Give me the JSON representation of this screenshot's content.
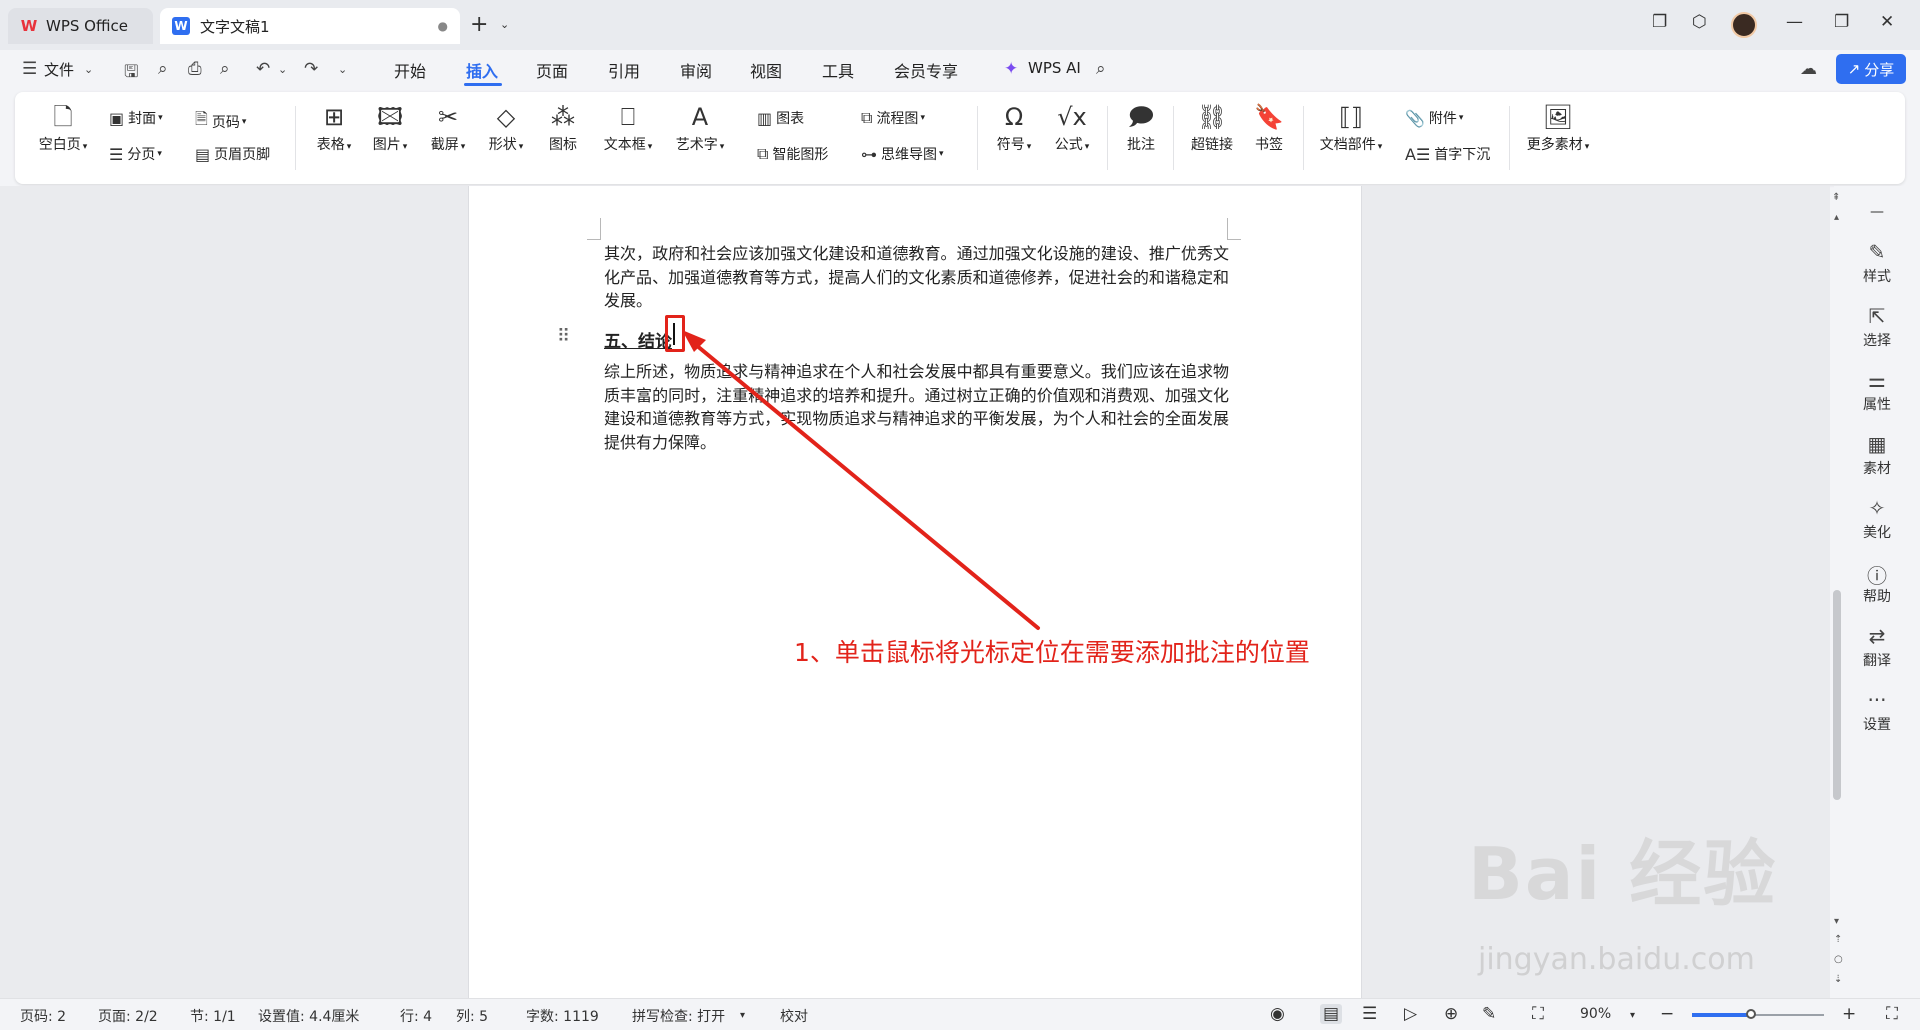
{
  "tabs": {
    "app_tab": "WPS Office",
    "doc_tab": "文字文稿1",
    "doc_tab_modified_dot": "●",
    "new_tab": "+"
  },
  "menu": {
    "file": "文件",
    "items": [
      "开始",
      "插入",
      "页面",
      "引用",
      "审阅",
      "视图",
      "工具",
      "会员专享"
    ],
    "active": "插入",
    "ai": "WPS AI",
    "share": "分享"
  },
  "ribbon": {
    "blank_page": "空白页",
    "cover": "封面",
    "page_number": "页码",
    "section_break": "分页",
    "header_footer": "页眉页脚",
    "table": "表格",
    "picture": "图片",
    "screenshot": "截屏",
    "shape": "形状",
    "icon": "图标",
    "textbox": "文本框",
    "wordart": "艺术字",
    "chart": "图表",
    "smartart": "智能图形",
    "flowchart": "流程图",
    "mindmap": "思维导图",
    "symbol": "符号",
    "formula": "公式",
    "comment": "批注",
    "hyperlink": "超链接",
    "bookmark": "书签",
    "doc_parts": "文档部件",
    "attachment": "附件",
    "drop_cap": "首字下沉",
    "more_materials": "更多素材"
  },
  "document": {
    "paragraph1": "其次，政府和社会应该加强文化建设和道德教育。通过加强文化设施的建设、推广优秀文化产品、加强道德教育等方式，提高人们的文化素质和道德修养，促进社会的和谐稳定和发展。",
    "heading": "五、结论",
    "paragraph2": "综上所述，物质追求与精神追求在个人和社会发展中都具有重要意义。我们应该在追求物质丰富的同时，注重精神追求的培养和提升。通过树立正确的价值观和消费观、加强文化建设和道德教育等方式，实现物质追求与精神追求的平衡发展，为个人和社会的全面发展提供有力保障。"
  },
  "annotation": {
    "text": "1、单击鼠标将光标定位在需要添加批注的位置",
    "color": "#e2231a"
  },
  "sidebar": {
    "items": [
      "样式",
      "选择",
      "属性",
      "素材",
      "美化",
      "帮助",
      "翻译",
      "设置"
    ]
  },
  "status": {
    "page_code": "页码: 2",
    "page": "页面: 2/2",
    "section": "节: 1/1",
    "setting_value": "设置值: 4.4厘米",
    "row": "行: 4",
    "col": "列: 5",
    "word_count": "字数: 1119",
    "spell_check": "拼写检查: 打开",
    "proofread": "校对",
    "zoom": "90%",
    "zoom_fraction": 0.45
  },
  "watermark": {
    "main": "Bai 经验",
    "sub": "jingyan.baidu.com"
  },
  "colors": {
    "accent": "#2f6ef0",
    "annotation": "#e2231a"
  }
}
